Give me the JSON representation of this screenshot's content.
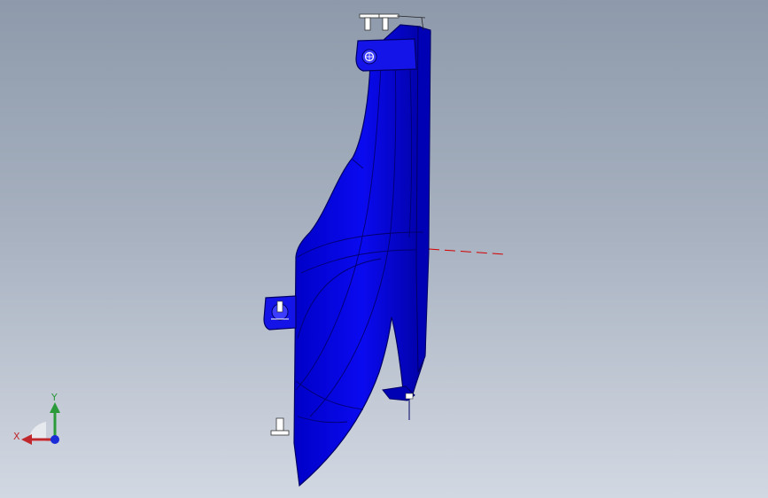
{
  "viewport": {
    "background_top": "#8e9aab",
    "background_bottom": "#d2d8e2"
  },
  "model": {
    "part_color": "#0a0ae6",
    "edge_color": "#000066",
    "hole_fill": "#3c3cff",
    "fastener_color": "#ffffff",
    "datum_line_color": "#d40000"
  },
  "triad": {
    "x_label": "X",
    "y_label": "Y",
    "x_color": "#c0282d",
    "y_color": "#2a9a3a",
    "z_color": "#1a2bd8"
  }
}
